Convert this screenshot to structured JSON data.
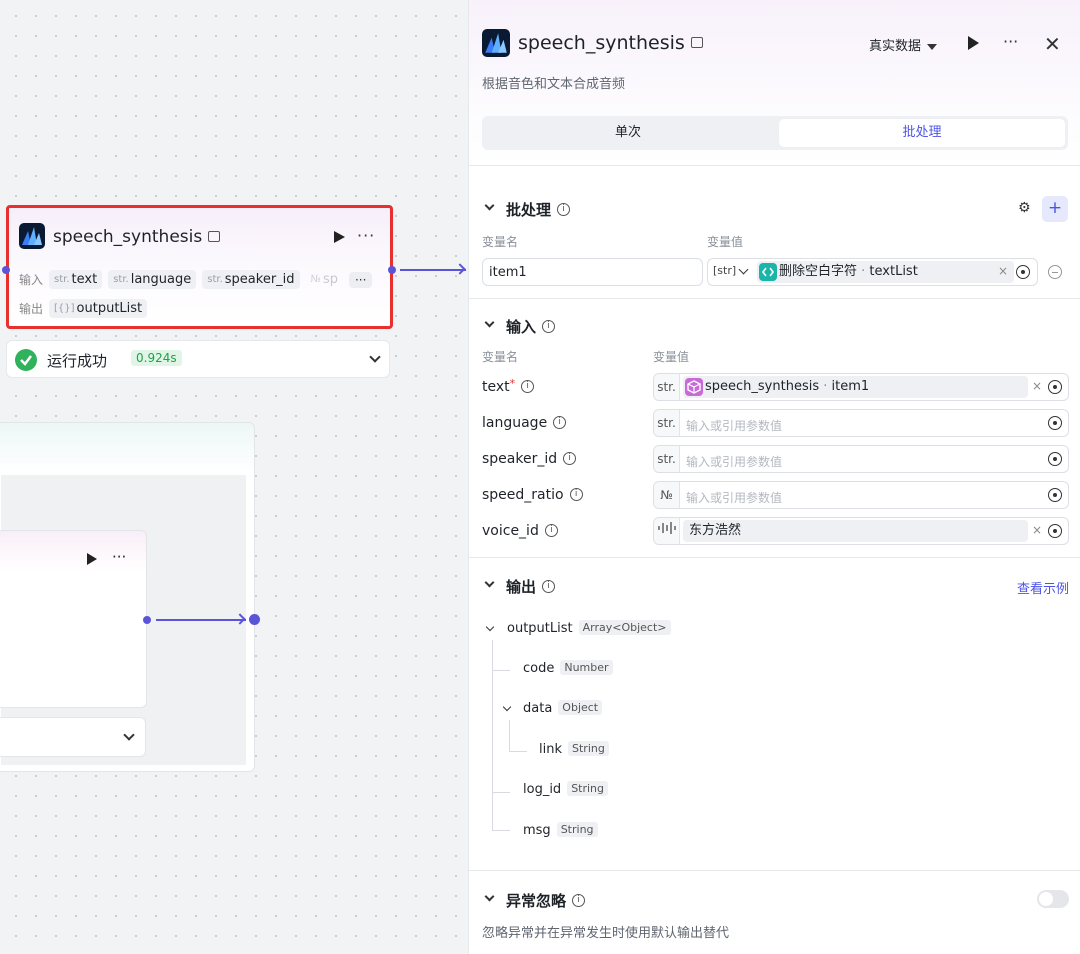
{
  "canvas": {
    "node": {
      "title": "speech_synthesis",
      "input_label": "输入",
      "output_label": "输出",
      "inputs": [
        {
          "type": "str.",
          "name": "text"
        },
        {
          "type": "str.",
          "name": "language"
        },
        {
          "type": "str.",
          "name": "speaker_id"
        },
        {
          "type": "№",
          "name": "sp"
        }
      ],
      "more_inputs": "···",
      "output_type": "[{}]",
      "output_name": "outputList",
      "more": "···"
    },
    "status": {
      "text": "运行成功",
      "time": "0.924s"
    },
    "inner_node": {
      "more": "···"
    }
  },
  "panel": {
    "title": "speech_synthesis",
    "real_data": "真实数据",
    "more": "···",
    "close": "✕",
    "description": "根据音色和文本合成音频",
    "tabs": {
      "single": "单次",
      "batch": "批处理"
    },
    "batch": {
      "title": "批处理",
      "col_name": "变量名",
      "col_value": "变量值",
      "item_name": "item1",
      "item_type": "[str]",
      "ref_source": "删除空白字符",
      "ref_sep": " · ",
      "ref_var": "textList",
      "add": "+"
    },
    "input": {
      "title": "输入",
      "col_name": "变量名",
      "col_value": "变量值",
      "params": [
        {
          "name": "text",
          "required": "*",
          "type": "str.",
          "value_source": "speech_synthesis",
          "value_var": "item1",
          "placeholder": ""
        },
        {
          "name": "language",
          "required": "",
          "type": "str.",
          "value_source": "",
          "value_var": "",
          "placeholder": "输入或引用参数值"
        },
        {
          "name": "speaker_id",
          "required": "",
          "type": "str.",
          "value_source": "",
          "value_var": "",
          "placeholder": "输入或引用参数值"
        },
        {
          "name": "speed_ratio",
          "required": "",
          "type": "№",
          "value_source": "",
          "value_var": "",
          "placeholder": "输入或引用参数值"
        },
        {
          "name": "voice_id",
          "required": "",
          "type": "|||",
          "value_source": "东方浩然",
          "value_var": "",
          "placeholder": ""
        }
      ]
    },
    "output": {
      "title": "输出",
      "example_link": "查看示例",
      "tree": [
        {
          "name": "outputList",
          "type": "Array<Object>"
        },
        {
          "name": "code",
          "type": "Number"
        },
        {
          "name": "data",
          "type": "Object"
        },
        {
          "name": "link",
          "type": "String"
        },
        {
          "name": "log_id",
          "type": "String"
        },
        {
          "name": "msg",
          "type": "String"
        }
      ]
    },
    "exception": {
      "title": "异常忽略",
      "description": "忽略异常并在异常发生时使用默认输出替代",
      "enabled": false
    }
  },
  "colors": {
    "accent": "#4d53e8",
    "highlight_border": "#e8302f",
    "success": "#2fb25b",
    "edge": "#5a55d8"
  }
}
